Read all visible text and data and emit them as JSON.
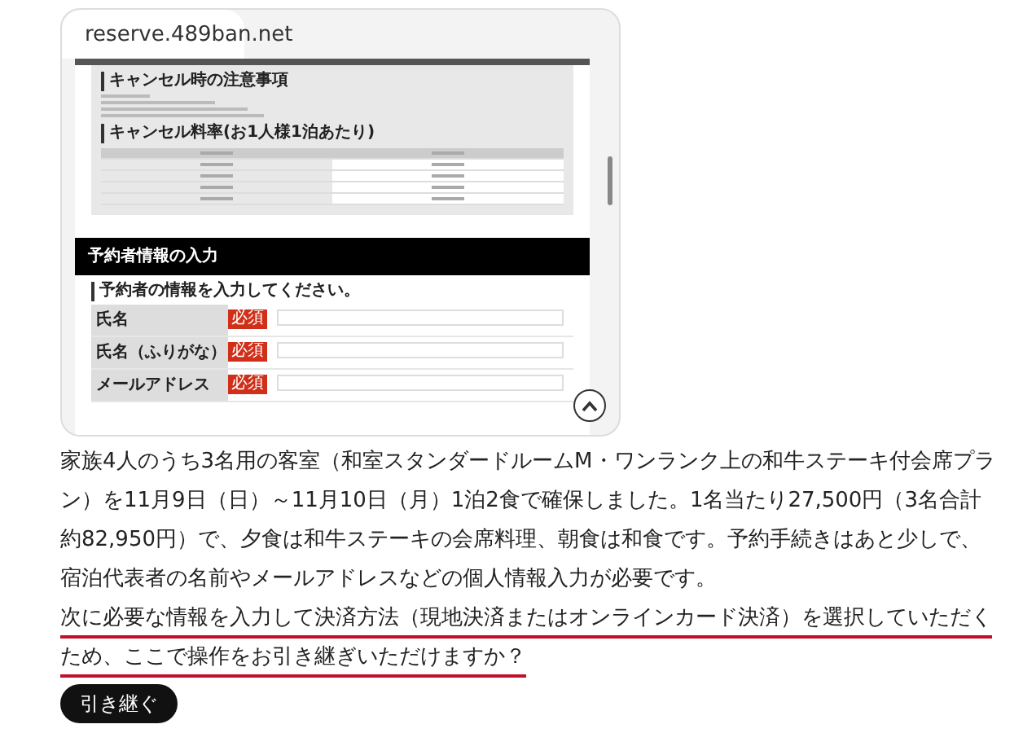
{
  "browser": {
    "url": "reserve.489ban.net"
  },
  "preview": {
    "cancel_notice_heading": "キャンセル時の注意事項",
    "cancel_rate_heading": "キャンセル料率(お1人様1泊あたり)",
    "section_title": "予約者情報の入力",
    "form_intro": "予約者の情報を入力してください。",
    "fields": [
      {
        "label": "氏名",
        "badge": "必須"
      },
      {
        "label": "氏名（ふりがな）",
        "badge": "必須"
      },
      {
        "label": "メールアドレス",
        "badge": "必須"
      }
    ]
  },
  "message": {
    "paragraphs": [
      {
        "text": "家族4人のうち3名用の客室（和室スタンダードルームM・ワンランク上の和牛ステーキ付会席プラン）を11月9日（日）～11月10日（月）1泊2食で確保しました。1名当たり27,500円（3名合計約82,950円）で、夕食は和牛ステーキの会席料理、朝食は和食です。予約手続きはあと少しで、宿泊代表者の名前やメールアドレスなどの個人情報入力が必要です。",
        "underlined": false
      },
      {
        "text": "次に必要な情報を入力して決済方法（現地決済またはオンラインカード決済）を選択していただくため、ここで操作をお引き継ぎいただけますか？",
        "underlined": true
      }
    ]
  },
  "continue_button": "引き継ぐ"
}
